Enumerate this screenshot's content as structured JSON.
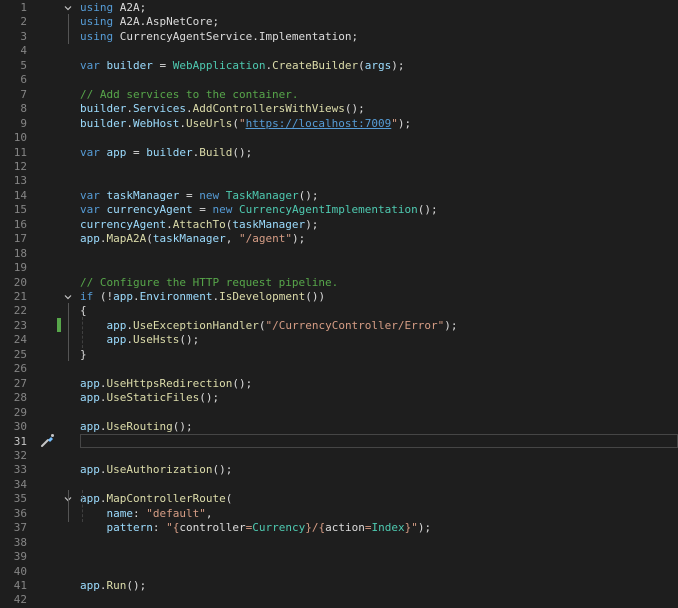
{
  "editor": {
    "current_line": 31,
    "changed_line": 23,
    "lines": [
      {
        "n": "1",
        "fold": true,
        "tokens": [
          {
            "t": "using",
            "c": "kw"
          },
          {
            "t": " A2A;",
            "c": "plain"
          }
        ]
      },
      {
        "n": "2",
        "tokens": [
          {
            "t": "using",
            "c": "kw"
          },
          {
            "t": " A2A.AspNetCore;",
            "c": "plain"
          }
        ]
      },
      {
        "n": "3",
        "tokens": [
          {
            "t": "using",
            "c": "kw"
          },
          {
            "t": " CurrencyAgentService.Implementation;",
            "c": "plain"
          }
        ]
      },
      {
        "n": "4",
        "tokens": []
      },
      {
        "n": "5",
        "tokens": [
          {
            "t": "var",
            "c": "kw"
          },
          {
            "t": " ",
            "c": "plain"
          },
          {
            "t": "builder",
            "c": "var"
          },
          {
            "t": " = ",
            "c": "plain"
          },
          {
            "t": "WebApplication",
            "c": "type"
          },
          {
            "t": ".",
            "c": "plain"
          },
          {
            "t": "CreateBuilder",
            "c": "fn"
          },
          {
            "t": "(",
            "c": "plain"
          },
          {
            "t": "args",
            "c": "var"
          },
          {
            "t": ");",
            "c": "plain"
          }
        ]
      },
      {
        "n": "6",
        "tokens": []
      },
      {
        "n": "7",
        "tokens": [
          {
            "t": "// Add services to the container.",
            "c": "cmt"
          }
        ]
      },
      {
        "n": "8",
        "tokens": [
          {
            "t": "builder",
            "c": "var"
          },
          {
            "t": ".",
            "c": "plain"
          },
          {
            "t": "Services",
            "c": "var"
          },
          {
            "t": ".",
            "c": "plain"
          },
          {
            "t": "AddControllersWithViews",
            "c": "fn"
          },
          {
            "t": "();",
            "c": "plain"
          }
        ]
      },
      {
        "n": "9",
        "tokens": [
          {
            "t": "builder",
            "c": "var"
          },
          {
            "t": ".",
            "c": "plain"
          },
          {
            "t": "WebHost",
            "c": "var"
          },
          {
            "t": ".",
            "c": "plain"
          },
          {
            "t": "UseUrls",
            "c": "fn"
          },
          {
            "t": "(",
            "c": "plain"
          },
          {
            "t": "\"",
            "c": "str"
          },
          {
            "t": "https://localhost:7009",
            "c": "url"
          },
          {
            "t": "\"",
            "c": "str"
          },
          {
            "t": ");",
            "c": "plain"
          }
        ]
      },
      {
        "n": "10",
        "tokens": []
      },
      {
        "n": "11",
        "tokens": [
          {
            "t": "var",
            "c": "kw"
          },
          {
            "t": " ",
            "c": "plain"
          },
          {
            "t": "app",
            "c": "var"
          },
          {
            "t": " = ",
            "c": "plain"
          },
          {
            "t": "builder",
            "c": "var"
          },
          {
            "t": ".",
            "c": "plain"
          },
          {
            "t": "Build",
            "c": "fn"
          },
          {
            "t": "();",
            "c": "plain"
          }
        ]
      },
      {
        "n": "12",
        "tokens": []
      },
      {
        "n": "13",
        "tokens": []
      },
      {
        "n": "14",
        "tokens": [
          {
            "t": "var",
            "c": "kw"
          },
          {
            "t": " ",
            "c": "plain"
          },
          {
            "t": "taskManager",
            "c": "var"
          },
          {
            "t": " = ",
            "c": "plain"
          },
          {
            "t": "new",
            "c": "kw"
          },
          {
            "t": " ",
            "c": "plain"
          },
          {
            "t": "TaskManager",
            "c": "type"
          },
          {
            "t": "();",
            "c": "plain"
          }
        ]
      },
      {
        "n": "15",
        "tokens": [
          {
            "t": "var",
            "c": "kw"
          },
          {
            "t": " ",
            "c": "plain"
          },
          {
            "t": "currencyAgent",
            "c": "var"
          },
          {
            "t": " = ",
            "c": "plain"
          },
          {
            "t": "new",
            "c": "kw"
          },
          {
            "t": " ",
            "c": "plain"
          },
          {
            "t": "CurrencyAgentImplementation",
            "c": "type"
          },
          {
            "t": "();",
            "c": "plain"
          }
        ]
      },
      {
        "n": "16",
        "tokens": [
          {
            "t": "currencyAgent",
            "c": "var"
          },
          {
            "t": ".",
            "c": "plain"
          },
          {
            "t": "AttachTo",
            "c": "fn"
          },
          {
            "t": "(",
            "c": "plain"
          },
          {
            "t": "taskManager",
            "c": "var"
          },
          {
            "t": ");",
            "c": "plain"
          }
        ]
      },
      {
        "n": "17",
        "tokens": [
          {
            "t": "app",
            "c": "var"
          },
          {
            "t": ".",
            "c": "plain"
          },
          {
            "t": "MapA2A",
            "c": "fn"
          },
          {
            "t": "(",
            "c": "plain"
          },
          {
            "t": "taskManager",
            "c": "var"
          },
          {
            "t": ", ",
            "c": "plain"
          },
          {
            "t": "\"/agent\"",
            "c": "str"
          },
          {
            "t": ");",
            "c": "plain"
          }
        ]
      },
      {
        "n": "18",
        "tokens": []
      },
      {
        "n": "19",
        "tokens": []
      },
      {
        "n": "20",
        "tokens": [
          {
            "t": "// Configure the HTTP request pipeline.",
            "c": "cmt"
          }
        ]
      },
      {
        "n": "21",
        "fold": true,
        "tokens": [
          {
            "t": "if",
            "c": "kw"
          },
          {
            "t": " (!",
            "c": "plain"
          },
          {
            "t": "app",
            "c": "var"
          },
          {
            "t": ".",
            "c": "plain"
          },
          {
            "t": "Environment",
            "c": "var"
          },
          {
            "t": ".",
            "c": "plain"
          },
          {
            "t": "IsDevelopment",
            "c": "fn"
          },
          {
            "t": "())",
            "c": "plain"
          }
        ]
      },
      {
        "n": "22",
        "tokens": [
          {
            "t": "{",
            "c": "plain"
          }
        ]
      },
      {
        "n": "23",
        "tokens": [
          {
            "t": "    ",
            "c": "plain"
          },
          {
            "t": "app",
            "c": "var"
          },
          {
            "t": ".",
            "c": "plain"
          },
          {
            "t": "UseExceptionHandler",
            "c": "fn"
          },
          {
            "t": "(",
            "c": "plain"
          },
          {
            "t": "\"/CurrencyController/Error\"",
            "c": "str"
          },
          {
            "t": ");",
            "c": "plain"
          }
        ]
      },
      {
        "n": "24",
        "tokens": [
          {
            "t": "    ",
            "c": "plain"
          },
          {
            "t": "app",
            "c": "var"
          },
          {
            "t": ".",
            "c": "plain"
          },
          {
            "t": "UseHsts",
            "c": "fn"
          },
          {
            "t": "();",
            "c": "plain"
          }
        ]
      },
      {
        "n": "25",
        "tokens": [
          {
            "t": "}",
            "c": "plain"
          }
        ]
      },
      {
        "n": "26",
        "tokens": []
      },
      {
        "n": "27",
        "tokens": [
          {
            "t": "app",
            "c": "var"
          },
          {
            "t": ".",
            "c": "plain"
          },
          {
            "t": "UseHttpsRedirection",
            "c": "fn"
          },
          {
            "t": "();",
            "c": "plain"
          }
        ]
      },
      {
        "n": "28",
        "tokens": [
          {
            "t": "app",
            "c": "var"
          },
          {
            "t": ".",
            "c": "plain"
          },
          {
            "t": "UseStaticFiles",
            "c": "fn"
          },
          {
            "t": "();",
            "c": "plain"
          }
        ]
      },
      {
        "n": "29",
        "tokens": []
      },
      {
        "n": "30",
        "tokens": [
          {
            "t": "app",
            "c": "var"
          },
          {
            "t": ".",
            "c": "plain"
          },
          {
            "t": "UseRouting",
            "c": "fn"
          },
          {
            "t": "();",
            "c": "plain"
          }
        ]
      },
      {
        "n": "31",
        "tokens": []
      },
      {
        "n": "32",
        "tokens": []
      },
      {
        "n": "33",
        "tokens": [
          {
            "t": "app",
            "c": "var"
          },
          {
            "t": ".",
            "c": "plain"
          },
          {
            "t": "UseAuthorization",
            "c": "fn"
          },
          {
            "t": "();",
            "c": "plain"
          }
        ]
      },
      {
        "n": "34",
        "tokens": []
      },
      {
        "n": "35",
        "fold": true,
        "tokens": [
          {
            "t": "app",
            "c": "var"
          },
          {
            "t": ".",
            "c": "plain"
          },
          {
            "t": "MapControllerRoute",
            "c": "fn"
          },
          {
            "t": "(",
            "c": "plain"
          }
        ]
      },
      {
        "n": "36",
        "tokens": [
          {
            "t": "    ",
            "c": "plain"
          },
          {
            "t": "name",
            "c": "var"
          },
          {
            "t": ": ",
            "c": "plain"
          },
          {
            "t": "\"default\"",
            "c": "str"
          },
          {
            "t": ",",
            "c": "plain"
          }
        ]
      },
      {
        "n": "37",
        "tokens": [
          {
            "t": "    ",
            "c": "plain"
          },
          {
            "t": "pattern",
            "c": "var"
          },
          {
            "t": ": ",
            "c": "plain"
          },
          {
            "t": "\"{",
            "c": "str"
          },
          {
            "t": "controller",
            "c": "plain"
          },
          {
            "t": "=",
            "c": "str"
          },
          {
            "t": "Currency",
            "c": "type"
          },
          {
            "t": "}/{",
            "c": "str"
          },
          {
            "t": "action",
            "c": "plain"
          },
          {
            "t": "=",
            "c": "str"
          },
          {
            "t": "Index",
            "c": "type"
          },
          {
            "t": "}\"",
            "c": "str"
          },
          {
            "t": ");",
            "c": "plain"
          }
        ]
      },
      {
        "n": "38",
        "tokens": []
      },
      {
        "n": "39",
        "tokens": []
      },
      {
        "n": "40",
        "tokens": []
      },
      {
        "n": "41",
        "tokens": [
          {
            "t": "app",
            "c": "var"
          },
          {
            "t": ".",
            "c": "plain"
          },
          {
            "t": "Run",
            "c": "fn"
          },
          {
            "t": "();",
            "c": "plain"
          }
        ]
      },
      {
        "n": "42",
        "tokens": []
      }
    ]
  },
  "icons": {
    "fold": "chevron-down-icon",
    "quick_action": "screwdriver-brush-icon"
  },
  "colors": {
    "background": "#1e1e1e",
    "keyword": "#569cd6",
    "type": "#4ec9b0",
    "method": "#dcdcaa",
    "variable": "#9cdcfe",
    "string": "#d69d85",
    "comment": "#57a64a",
    "line_number": "#858585",
    "change_bar": "#57a64a"
  }
}
